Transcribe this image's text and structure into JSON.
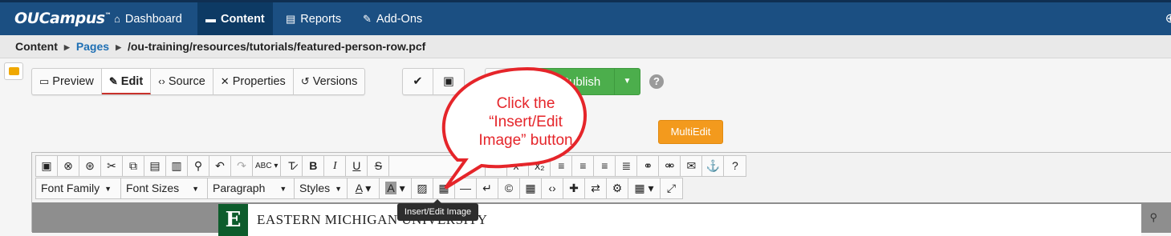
{
  "app": {
    "logo": "OUCampus",
    "logo_mark": "™"
  },
  "nav": {
    "items": [
      {
        "label": "Dashboard",
        "icon": "home-icon"
      },
      {
        "label": "Content",
        "icon": "folder-icon",
        "active": true
      },
      {
        "label": "Reports",
        "icon": "report-icon"
      },
      {
        "label": "Add-Ons",
        "icon": "plug-icon"
      }
    ]
  },
  "breadcrumb": {
    "root": "Content",
    "pages": "Pages",
    "path": "/ou-training/resources/tutorials/featured-person-row.pcf"
  },
  "page_actions": {
    "preview": "Preview",
    "edit": "Edit",
    "source": "Source",
    "properties": "Properties",
    "versions": "Versions",
    "publish": "Publish",
    "multiedit": "MultiEdit"
  },
  "toolbar": {
    "font_family": "Font Family",
    "font_sizes": "Font Sizes",
    "paragraph": "Paragraph",
    "styles": "Styles"
  },
  "tooltip": "Insert/Edit Image",
  "callout": {
    "text": "Click the “Insert/Edit Image” button"
  },
  "preview_content": {
    "logo_letter": "E",
    "university": "EASTERN MICHIGAN UNIVERSITY"
  },
  "colors": {
    "nav": "#1b4f82",
    "publish": "#4cae4c",
    "multiedit": "#f39a1d",
    "callout": "#e5252a",
    "emu_green": "#0d5c2c"
  }
}
